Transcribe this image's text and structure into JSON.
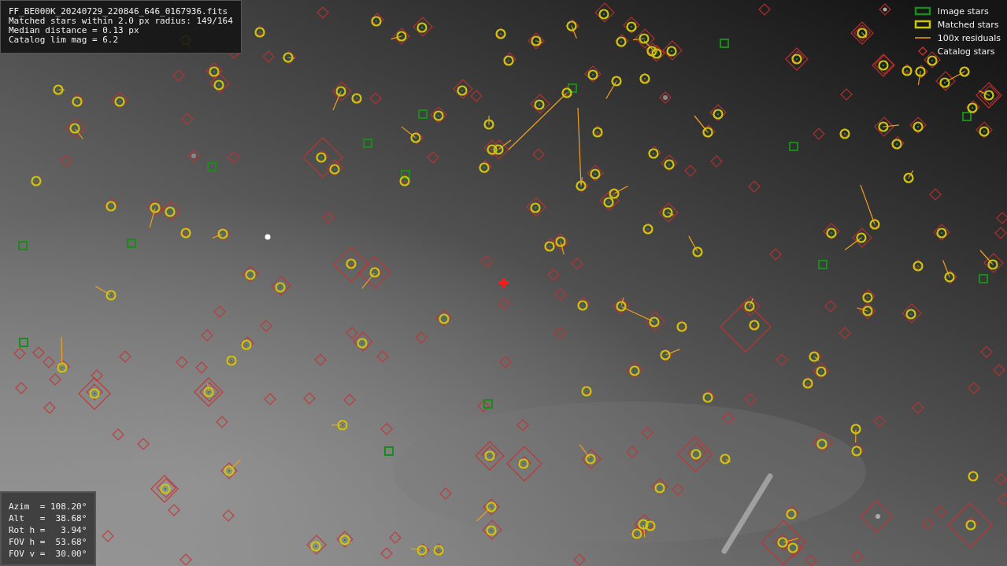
{
  "header": {
    "lines": [
      "FF_BE000K_20240729_220846_646_0167936.fits",
      "Matched stars within 2.0 px radius: 149/164",
      "Median distance = 0.13 px",
      "Catalog lim mag = 6.2"
    ]
  },
  "legend": [
    {
      "label": "Image stars"
    },
    {
      "label": "Matched stars",
      "kind": "matched"
    },
    {
      "label": "100x residuals",
      "kind": "residual"
    },
    {
      "label": "Catalog stars",
      "kind": "catalog"
    }
  ],
  "pointing": {
    "lines": [
      "Azim  = 108.20°",
      "Alt   =  38.68°",
      "Rot h =   3.94°",
      "FOV h =  53.68°",
      "FOV v =  30.00°"
    ]
  }
}
